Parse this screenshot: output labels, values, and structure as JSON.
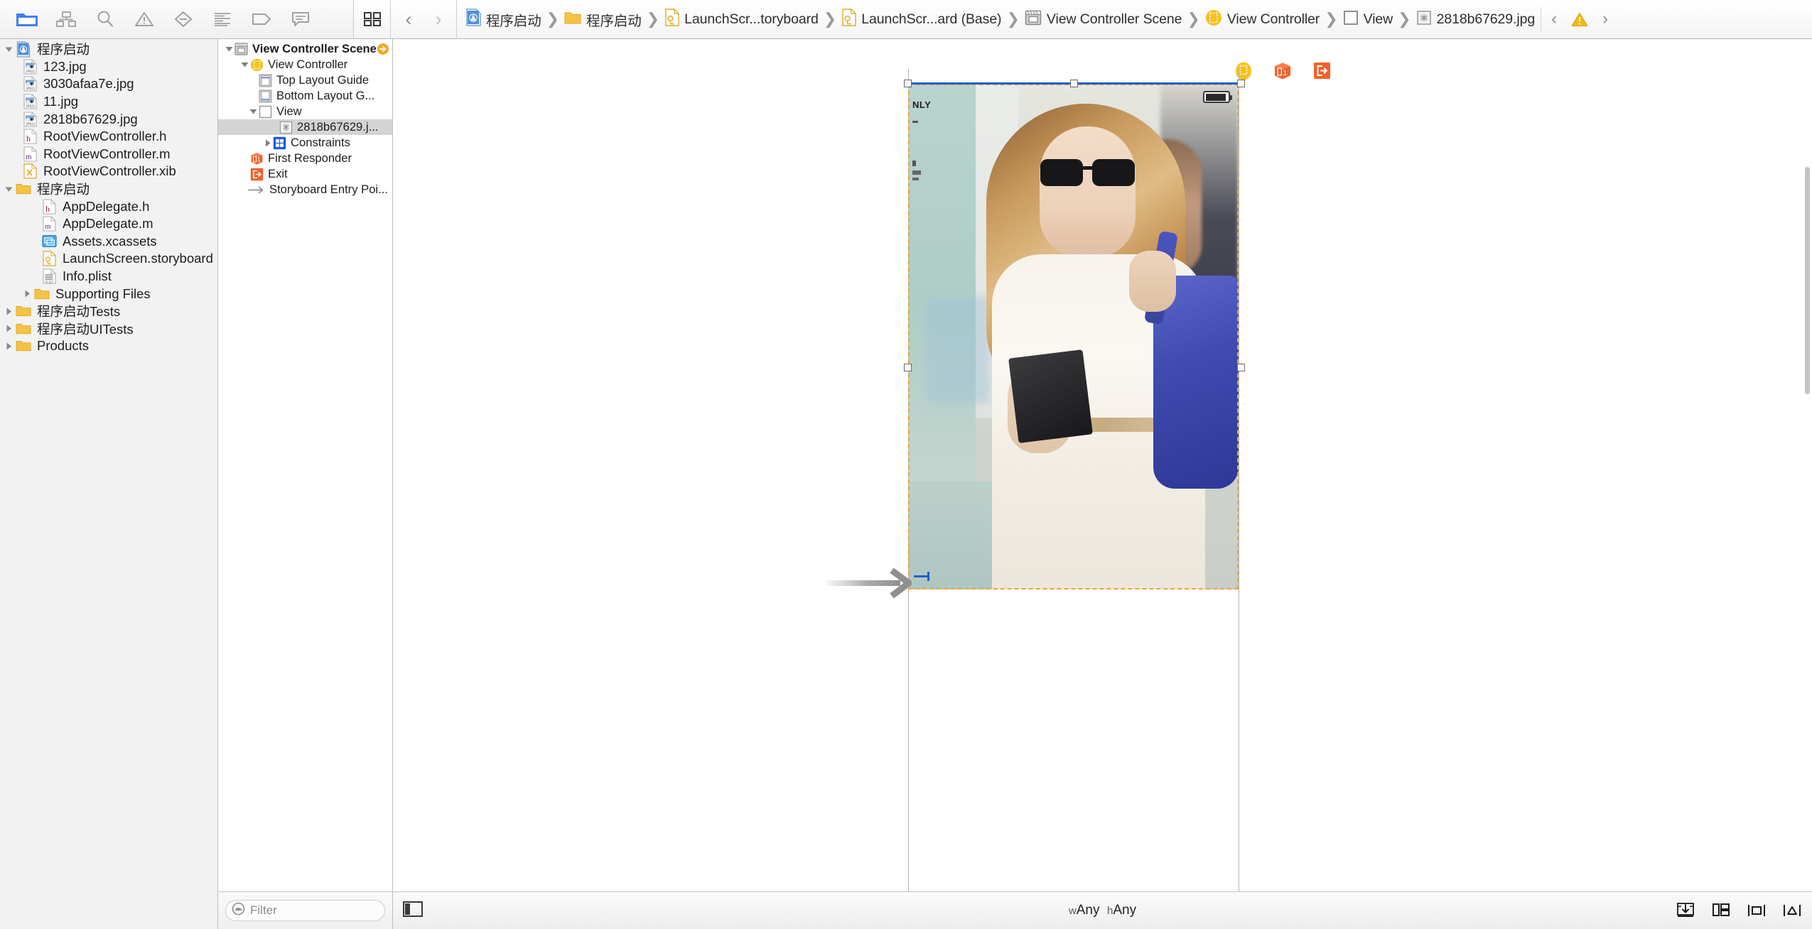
{
  "toolbar": {
    "nav_buttons": [
      {
        "name": "project-navigator",
        "icon": "folder-icon",
        "label": "Project navigator",
        "active": true
      },
      {
        "name": "symbol-navigator",
        "icon": "hierarchy-icon",
        "label": "Symbol navigator",
        "active": false
      },
      {
        "name": "find-navigator",
        "icon": "search-icon",
        "label": "Find navigator",
        "active": false
      },
      {
        "name": "issue-navigator",
        "icon": "warning-triangle-icon",
        "label": "Issue navigator",
        "active": false
      },
      {
        "name": "test-navigator",
        "icon": "diamond-minus-icon",
        "label": "Test navigator",
        "active": false
      },
      {
        "name": "debug-navigator",
        "icon": "list-lines-icon",
        "label": "Debug navigator",
        "active": false
      },
      {
        "name": "breakpoint-navigator",
        "icon": "tag-icon",
        "label": "Breakpoint navigator",
        "active": false
      },
      {
        "name": "report-navigator",
        "icon": "speech-bubble-icon",
        "label": "Report navigator",
        "active": false
      }
    ],
    "editor_mode_icon": "related-items-icon",
    "back_label": "‹",
    "forward_label": "›",
    "tail_back_label": "‹",
    "tail_forward_label": "›",
    "tail_warning_icon": "warning-triangle-icon"
  },
  "breadcrumbs": [
    {
      "icon": "xcode-project-icon",
      "label": "程序启动"
    },
    {
      "icon": "folder-icon",
      "label": "程序启动"
    },
    {
      "icon": "storyboard-icon",
      "label": "LaunchScr...toryboard"
    },
    {
      "icon": "storyboard-icon",
      "label": "LaunchScr...ard (Base)"
    },
    {
      "icon": "scene-icon",
      "label": "View Controller Scene"
    },
    {
      "icon": "view-controller-icon",
      "label": "View Controller"
    },
    {
      "icon": "view-icon",
      "label": "View"
    },
    {
      "icon": "image-view-icon",
      "label": "2818b67629.jpg"
    }
  ],
  "navigator": {
    "items": [
      {
        "indent": 0,
        "twisty": "down",
        "icon": "xcode-project-icon",
        "label": "程序启动"
      },
      {
        "indent": 1,
        "twisty": "none",
        "icon": "jpeg-icon",
        "label": "123.jpg"
      },
      {
        "indent": 1,
        "twisty": "none",
        "icon": "jpeg-icon",
        "label": "3030afaa7e.jpg"
      },
      {
        "indent": 1,
        "twisty": "none",
        "icon": "jpeg-icon",
        "label": "11.jpg"
      },
      {
        "indent": 1,
        "twisty": "none",
        "icon": "jpeg-icon",
        "label": "2818b67629.jpg"
      },
      {
        "indent": 1,
        "twisty": "none",
        "icon": "header-h-icon",
        "label": "RootViewController.h"
      },
      {
        "indent": 1,
        "twisty": "none",
        "icon": "source-m-icon",
        "label": "RootViewController.m"
      },
      {
        "indent": 1,
        "twisty": "none",
        "icon": "xib-icon",
        "label": "RootViewController.xib"
      },
      {
        "indent": 0,
        "twisty": "down",
        "icon": "folder-icon",
        "label": "程序启动"
      },
      {
        "indent": 2,
        "twisty": "none",
        "icon": "header-h-icon",
        "label": "AppDelegate.h"
      },
      {
        "indent": 2,
        "twisty": "none",
        "icon": "source-m-icon",
        "label": "AppDelegate.m"
      },
      {
        "indent": 2,
        "twisty": "none",
        "icon": "xcassets-icon",
        "label": "Assets.xcassets"
      },
      {
        "indent": 2,
        "twisty": "none",
        "icon": "storyboard-icon",
        "label": "LaunchScreen.storyboard"
      },
      {
        "indent": 2,
        "twisty": "none",
        "icon": "plist-icon",
        "label": "Info.plist"
      },
      {
        "indent": 1,
        "twisty": "right",
        "icon": "folder-icon",
        "label": "Supporting Files"
      },
      {
        "indent": 0,
        "twisty": "right",
        "icon": "folder-icon",
        "label": "程序启动Tests"
      },
      {
        "indent": 0,
        "twisty": "right",
        "icon": "folder-icon",
        "label": "程序启动UITests"
      },
      {
        "indent": 0,
        "twisty": "right",
        "icon": "folder-icon",
        "label": "Products"
      }
    ]
  },
  "outline": {
    "items": [
      {
        "indent": 0,
        "twisty": "down",
        "icon": "scene-icon",
        "label": "View Controller Scene",
        "bold": true,
        "selected": false,
        "badge": "scene-arrow-badge"
      },
      {
        "indent": 1,
        "twisty": "down",
        "icon": "view-controller-icon",
        "label": "View Controller",
        "bold": false,
        "selected": false
      },
      {
        "indent": 2,
        "twisty": "none",
        "icon": "top-layout-guide-icon",
        "label": "Top Layout Guide",
        "bold": false,
        "selected": false
      },
      {
        "indent": 2,
        "twisty": "none",
        "icon": "bottom-layout-guide-icon",
        "label": "Bottom Layout G...",
        "bold": false,
        "selected": false
      },
      {
        "indent": 2,
        "twisty": "down",
        "icon": "view-icon",
        "label": "View",
        "bold": false,
        "selected": false
      },
      {
        "indent": 3,
        "twisty": "none",
        "icon": "image-view-icon",
        "label": "2818b67629.j...",
        "bold": false,
        "selected": true
      },
      {
        "indent": 3,
        "twisty": "right",
        "icon": "constraints-icon",
        "label": "Constraints",
        "bold": false,
        "selected": false
      },
      {
        "indent": 1,
        "twisty": "none",
        "icon": "first-responder-icon",
        "label": "First Responder",
        "bold": false,
        "selected": false
      },
      {
        "indent": 1,
        "twisty": "none",
        "icon": "exit-icon",
        "label": "Exit",
        "bold": false,
        "selected": false
      },
      {
        "indent": 1,
        "twisty": "none",
        "icon": "entry-point-arrow-icon",
        "label": "Storyboard Entry Poi...",
        "bold": false,
        "selected": false
      }
    ],
    "filter_placeholder": "Filter",
    "filter_value": "",
    "filter_icon": "filter-round-icon"
  },
  "canvas": {
    "trait_width_prefix": "w",
    "trait_width_value": "Any",
    "trait_height_prefix": "h",
    "trait_height_value": "Any",
    "left_panel_toggle_icon": "left-panel-toggle-icon",
    "bottom_buttons": [
      {
        "name": "update-frames-button",
        "icon": "update-frames-icon"
      },
      {
        "name": "embed-in-button",
        "icon": "embed-in-icon"
      },
      {
        "name": "align-button",
        "icon": "align-icon"
      },
      {
        "name": "resolve-issues-button",
        "icon": "pin-constraints-icon"
      }
    ],
    "scene_dock_icons": [
      {
        "name": "view-controller-dock-icon",
        "icon": "view-controller-icon"
      },
      {
        "name": "first-responder-dock-icon",
        "icon": "first-responder-icon"
      },
      {
        "name": "exit-dock-icon",
        "icon": "exit-icon"
      }
    ],
    "status_bar_battery_icon": "battery-icon",
    "photo_overlay_text": "NLY",
    "selection_color": "#1f5fd0",
    "selection_dash_color": "#f0a33c"
  },
  "colors": {
    "accent_blue": "#3f7ff2",
    "folder_yellow": "#f5c243",
    "warning_yellow": "#f7b719",
    "orange": "#f4602a",
    "selection_gray": "#d4d4d4"
  }
}
